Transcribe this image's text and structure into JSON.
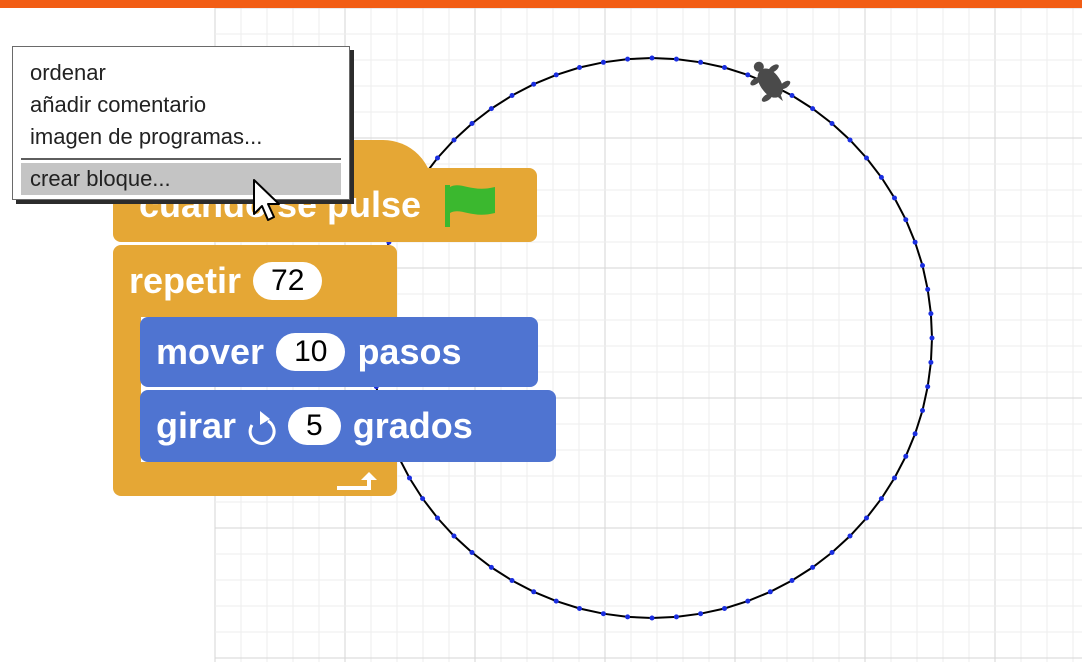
{
  "context_menu": {
    "items": [
      {
        "label": "ordenar"
      },
      {
        "label": "añadir comentario"
      },
      {
        "label": "imagen de programas..."
      },
      {
        "label": "crear bloque..."
      }
    ],
    "highlighted_index": 3
  },
  "script": {
    "hat": {
      "text": "cuando se pulse",
      "icon": "green-flag-icon"
    },
    "repeat": {
      "label": "repetir",
      "value": "72"
    },
    "move": {
      "label": "mover",
      "value": "10",
      "unit": "pasos"
    },
    "turn": {
      "label": "girar",
      "icon": "rotate-clockwise-icon",
      "value": "5",
      "unit": "grados"
    }
  },
  "stage": {
    "path": {
      "segments": 72,
      "step": 10,
      "turn_degrees": 5
    },
    "sprite": "turtle-icon"
  },
  "colors": {
    "top_bar": "#f25d14",
    "control_block": "#e5a735",
    "motion_block": "#4f74d1",
    "flag": "#3bb82f",
    "path_line": "#000000",
    "path_dots": "#1a2ee0",
    "turtle": "#4a4a4a",
    "menu_highlight": "#c4c4c4"
  }
}
